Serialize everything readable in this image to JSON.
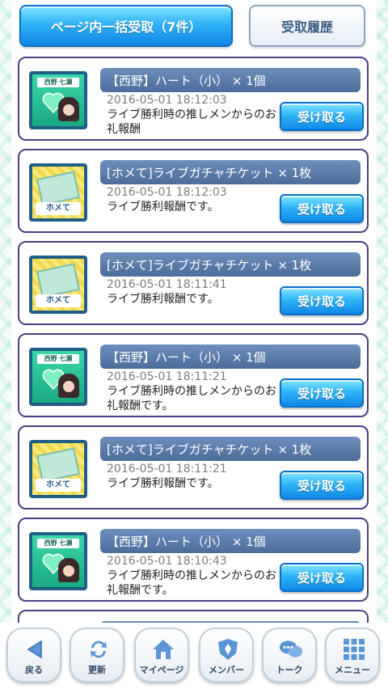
{
  "top": {
    "bulk_receive_label": "ページ内一括受取（7件）",
    "history_label": "受取履歴"
  },
  "items": [
    {
      "kind": "heart",
      "thumb_tag": "西野 七瀬",
      "title": "【西野】ハート（小） × 1個",
      "date": "2016-05-01 18:12:03",
      "description": "ライブ勝利時の推しメンからのお礼報酬",
      "button": "受け取る"
    },
    {
      "kind": "ticket",
      "thumb_tag": "ホメて",
      "title": "[ホメて]ライブガチャチケット × 1枚",
      "date": "2016-05-01 18:12:03",
      "description": "ライブ勝利報酬です。",
      "button": "受け取る"
    },
    {
      "kind": "ticket",
      "thumb_tag": "ホメて",
      "title": "[ホメて]ライブガチャチケット × 1枚",
      "date": "2016-05-01 18:11:41",
      "description": "ライブ勝利報酬です。",
      "button": "受け取る"
    },
    {
      "kind": "heart",
      "thumb_tag": "西野 七瀬",
      "title": "【西野】ハート（小） × 1個",
      "date": "2016-05-01 18:11:21",
      "description": "ライブ勝利時の推しメンからのお礼報酬です。",
      "button": "受け取る"
    },
    {
      "kind": "ticket",
      "thumb_tag": "ホメて",
      "title": "[ホメて]ライブガチャチケット × 1枚",
      "date": "2016-05-01 18:11:21",
      "description": "ライブ勝利報酬です。",
      "button": "受け取る"
    },
    {
      "kind": "heart",
      "thumb_tag": "西野 七瀬",
      "title": "【西野】ハート（小） × 1個",
      "date": "2016-05-01 18:10:43",
      "description": "ライブ勝利時の推しメンからのお礼報酬です。",
      "button": "受け取る"
    }
  ],
  "nav": [
    {
      "label": "戻る",
      "icon": "back-arrow-icon"
    },
    {
      "label": "更新",
      "icon": "refresh-icon"
    },
    {
      "label": "マイページ",
      "icon": "home-icon"
    },
    {
      "label": "メンバー",
      "icon": "member-shield-icon"
    },
    {
      "label": "トーク",
      "icon": "chat-bubble-icon"
    },
    {
      "label": "メニュー",
      "icon": "menu-grid-icon"
    }
  ],
  "colors": {
    "accent_blue": "#1f9ff0",
    "card_border": "#4b3f86",
    "title_bar": "#5a7aa8",
    "nav_text": "#2c4766"
  }
}
